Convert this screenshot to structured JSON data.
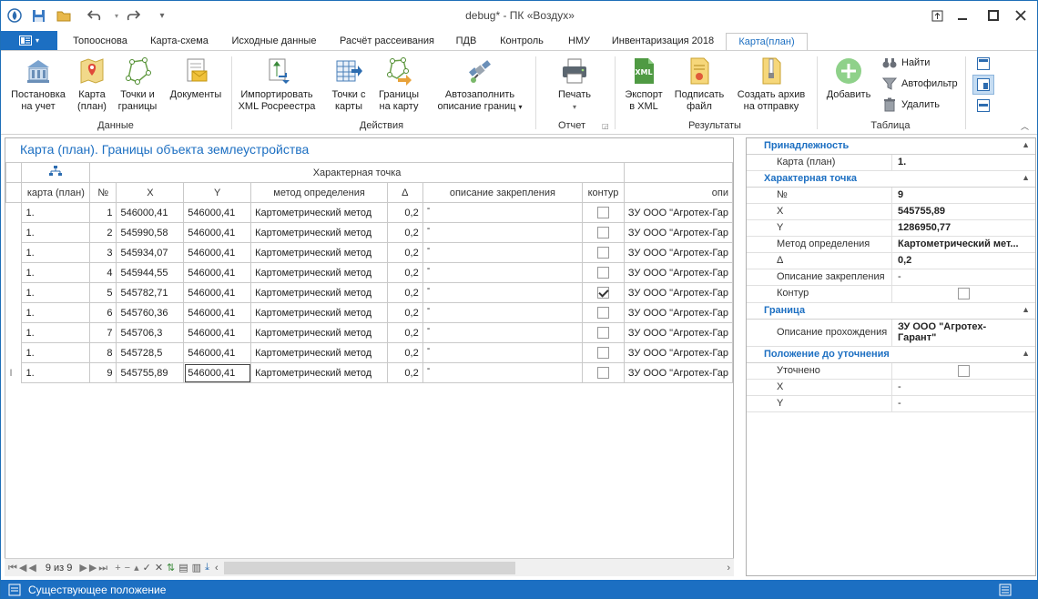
{
  "window": {
    "title": "debug* - ПК «Воздух»"
  },
  "tabs": [
    "Топооснова",
    "Карта-схема",
    "Исходные данные",
    "Расчёт рассеивания",
    "ПДВ",
    "Контроль",
    "НМУ",
    "Инвентаризация 2018",
    "Карта(план)"
  ],
  "ribbon": {
    "btn": {
      "postanovka": "Постановка",
      "postanovka2": "на учет",
      "karta": "Карта",
      "karta2": "(план)",
      "tochki": "Точки и",
      "tochki2": "границы",
      "docs": "Документы",
      "import": "Импортировать",
      "import2": "XML Росреестра",
      "tochki_s": "Точки с",
      "tochki_s2": "карты",
      "granicy": "Границы",
      "granicy2": "на карту",
      "autofill": "Автозаполнить",
      "autofill2": "описание границ",
      "print": "Печать",
      "export": "Экспорт",
      "export2": "в XML",
      "sign": "Подписать",
      "sign2": "файл",
      "archive": "Создать архив",
      "archive2": "на отправку",
      "add": "Добавить",
      "find": "Найти",
      "autofilter": "Автофильтр",
      "delete": "Удалить"
    },
    "groups": {
      "data": "Данные",
      "actions": "Действия",
      "report": "Отчет",
      "results": "Результаты",
      "table": "Таблица"
    }
  },
  "grid": {
    "title": "Карта (план). Границы объекта землеустройства",
    "band": "Характерная точка",
    "headers": [
      "карта (план)",
      "№",
      "X",
      "Y",
      "метод определения",
      "Δ",
      "описание закрепления",
      "контур",
      "опи"
    ],
    "rows": [
      {
        "map": "1.",
        "n": "1",
        "x": "546000,41",
        "y": "546000,41",
        "method": "Картометрический метод",
        "d": "0,2",
        "desc": "-",
        "contour": false,
        "op": "ЗУ ООО \"Агротех-Гар"
      },
      {
        "map": "1.",
        "n": "2",
        "x": "545990,58",
        "y": "546000,41",
        "method": "Картометрический метод",
        "d": "0,2",
        "desc": "-",
        "contour": false,
        "op": "ЗУ ООО \"Агротех-Гар"
      },
      {
        "map": "1.",
        "n": "3",
        "x": "545934,07",
        "y": "546000,41",
        "method": "Картометрический метод",
        "d": "0,2",
        "desc": "-",
        "contour": false,
        "op": "ЗУ ООО \"Агротех-Гар"
      },
      {
        "map": "1.",
        "n": "4",
        "x": "545944,55",
        "y": "546000,41",
        "method": "Картометрический метод",
        "d": "0,2",
        "desc": "-",
        "contour": false,
        "op": "ЗУ ООО \"Агротех-Гар"
      },
      {
        "map": "1.",
        "n": "5",
        "x": "545782,71",
        "y": "546000,41",
        "method": "Картометрический метод",
        "d": "0,2",
        "desc": "-",
        "contour": true,
        "op": "ЗУ ООО \"Агротех-Гар"
      },
      {
        "map": "1.",
        "n": "6",
        "x": "545760,36",
        "y": "546000,41",
        "method": "Картометрический метод",
        "d": "0,2",
        "desc": "-",
        "contour": false,
        "op": "ЗУ ООО \"Агротех-Гар"
      },
      {
        "map": "1.",
        "n": "7",
        "x": "545706,3",
        "y": "546000,41",
        "method": "Картометрический метод",
        "d": "0,2",
        "desc": "-",
        "contour": false,
        "op": "ЗУ ООО \"Агротех-Гар"
      },
      {
        "map": "1.",
        "n": "8",
        "x": "545728,5",
        "y": "546000,41",
        "method": "Картометрический метод",
        "d": "0,2",
        "desc": "-",
        "contour": false,
        "op": "ЗУ ООО \"Агротех-Гар"
      },
      {
        "map": "1.",
        "n": "9",
        "x": "545755,89",
        "y": "546000,41",
        "method": "Картометрический метод",
        "d": "0,2",
        "desc": "-",
        "contour": false,
        "op": "ЗУ ООО \"Агротех-Гар"
      }
    ],
    "nav": "9 из 9"
  },
  "props": {
    "c1": "Принадлежность",
    "map_k": "Карта (план)",
    "map_v": "1.",
    "c2": "Характерная точка",
    "n_k": "№",
    "n_v": "9",
    "x_k": "X",
    "x_v": "545755,89",
    "y_k": "Y",
    "y_v": "1286950,77",
    "m_k": "Метод определения",
    "m_v": "Картометрический мет...",
    "d_k": "Δ",
    "d_v": "0,2",
    "desc_k": "Описание закрепления",
    "desc_v": "-",
    "cont_k": "Контур",
    "c3": "Граница",
    "pass_k": "Описание прохождения",
    "pass_v1": "ЗУ ООО \"Агротех-",
    "pass_v2": "Гарант\"",
    "c4": "Положение до уточнения",
    "ut_k": "Уточнено",
    "x2_k": "X",
    "x2_v": "-",
    "y2_k": "Y",
    "y2_v": "-"
  },
  "status": "Существующее положение",
  "colors": {
    "accent": "#1c6fc2"
  }
}
